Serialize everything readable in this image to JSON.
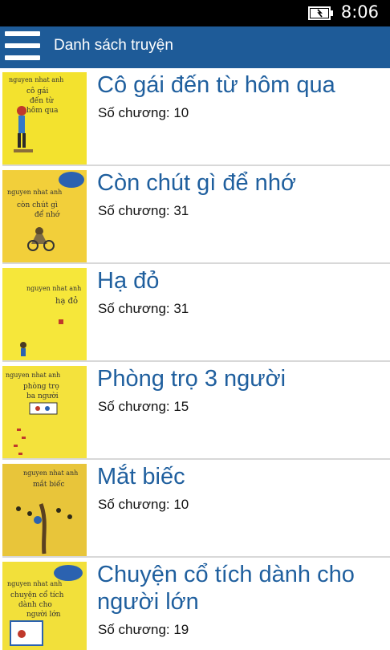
{
  "status_bar": {
    "time": "8:06",
    "battery_icon": "battery-charging-icon"
  },
  "header": {
    "menu_icon": "hamburger-menu-icon",
    "title": "Danh sách truyện"
  },
  "books": [
    {
      "title": "Cô gái đến từ hôm qua",
      "chapters": "Số chương: 10",
      "cover_text": "nguyen nhat anh"
    },
    {
      "title": "Còn chút gì để nhớ",
      "chapters": "Số chương: 31",
      "cover_text": "nguyen nhat anh"
    },
    {
      "title": "Hạ đỏ",
      "chapters": "Số chương: 31",
      "cover_text": "nguyen nhat anh"
    },
    {
      "title": "Phòng trọ 3 người",
      "chapters": "Số chương: 15",
      "cover_text": "nguyen nhat anh"
    },
    {
      "title": "Mắt biếc",
      "chapters": "Số chương: 10",
      "cover_text": "nguyen nhat anh"
    },
    {
      "title": "Chuyện cổ tích dành cho người lớn",
      "chapters": "Số chương: 19",
      "cover_text": "nguyen nhat anh"
    }
  ],
  "colors": {
    "app_bar": "#1e5b98",
    "title_text": "#1f5f9e",
    "cover_yellow": "#f3e22e"
  }
}
